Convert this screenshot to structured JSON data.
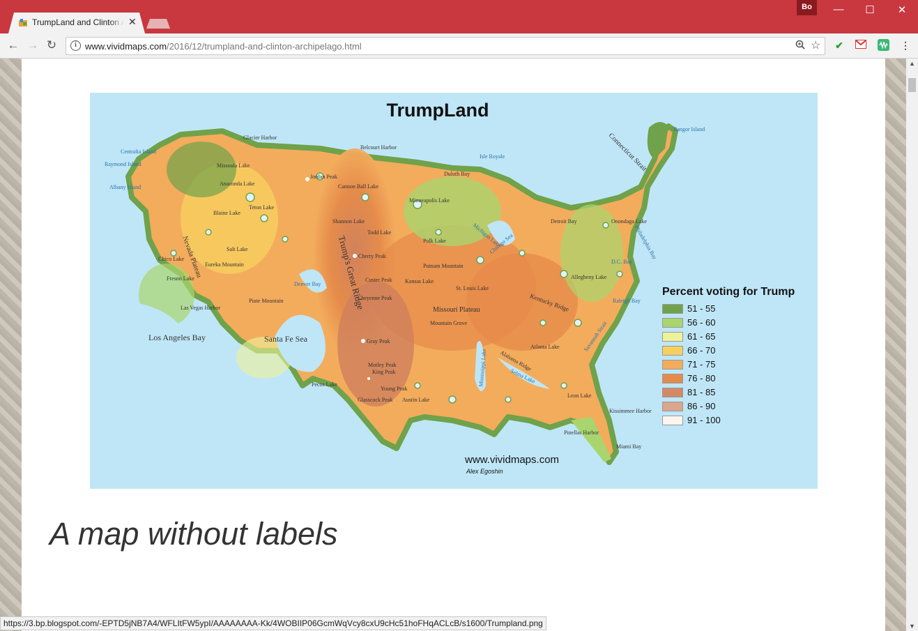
{
  "browser": {
    "tab_title": "TrumpLand and Clinton Archipelago",
    "profile_label": "Bo",
    "window_controls": {
      "minimize": "—",
      "maximize": "☐",
      "close": "✕"
    },
    "url_host": "www.vividmaps.com",
    "url_path": "/2016/12/trumpland-and-clinton-archipelago.html",
    "status_url": "https://3.bp.blogspot.com/-EPTD5jNB7A4/WFLItFW5ypI/AAAAAAAA-Kk/4WOBIIP06GcmWqVcy8cxU9cHc51hoFHqACLcB/s1600/Trumpland.png",
    "icons": {
      "back": "back-arrow-icon",
      "forward": "forward-arrow-icon",
      "reload": "reload-icon",
      "info": "info-icon",
      "zoom": "zoom-icon",
      "bookmark": "star-icon",
      "menu": "kebab-menu-icon"
    }
  },
  "map": {
    "title": "TrumpLand",
    "legend_title": "Percent voting for Trump",
    "legend": [
      {
        "label": "51 - 55",
        "color": "#6fa24a"
      },
      {
        "label": "56 - 60",
        "color": "#a9d56e"
      },
      {
        "label": "61 - 65",
        "color": "#eef29a"
      },
      {
        "label": "66 - 70",
        "color": "#f7cf5f"
      },
      {
        "label": "71 - 75",
        "color": "#f3ac5c"
      },
      {
        "label": "76 - 80",
        "color": "#e58a4a"
      },
      {
        "label": "81 - 85",
        "color": "#d28a66"
      },
      {
        "label": "86 - 90",
        "color": "#d9a68e"
      },
      {
        "label": "91 - 100",
        "color": "#fbf5ef"
      }
    ],
    "credit_site": "www.vividmaps.com",
    "credit_author": "Alex Egoshin",
    "water_labels": [
      "Centralia Island",
      "Raymond Island",
      "Albany Island",
      "Isle Royale",
      "Bangor Island"
    ],
    "place_labels": [
      "Glacier Harbor",
      "Belcourt Harbor",
      "Duluth Bay",
      "Missoula Lake",
      "Anaconda Lake",
      "Jordan Peak",
      "Cannon Ball Lake",
      "Teton Lake",
      "Blaine Lake",
      "Shannon Lake",
      "Todd Lake",
      "Minneapolis Lake",
      "Connecticut Strait",
      "Detroit Bay",
      "Onondaga Lake",
      "Chicago Sea",
      "Michigan Lake",
      "Salt Lake",
      "Eureka Mountain",
      "Nevada Plateau",
      "Chico Lake",
      "Fresno Lake",
      "Cherry Peak",
      "Polk Lake",
      "Putnam Mountain",
      "Custer Peak",
      "Kansas Lake",
      "Denver Bay",
      "St. Louis Lake",
      "Cheyenne Peak",
      "Missouri Plateau",
      "Trump's Great Ridge",
      "Kentucky Ridge",
      "Allegheny Lake",
      "D.C. Bay",
      "Raleigh Bay",
      "Piute Mountain",
      "Las Vegas Harbor",
      "Mountain Grove",
      "Gray Peak",
      "Alabama Ridge",
      "Atlanta Lake",
      "Motley Peak",
      "King Peak",
      "Selma Lake",
      "Mississippi Lake",
      "Savannah Strait",
      "Pecos Lake",
      "Young Peak",
      "Glasscock Peak",
      "Austin Lake",
      "Leon Lake",
      "Kissimmee Harbor",
      "Pinellas Harbor",
      "Miami Bay",
      "Philadelphia Bay"
    ],
    "sea_labels": [
      "Los Angeles Bay",
      "Santa Fe Sea"
    ]
  },
  "page": {
    "heading": "A map without labels"
  }
}
